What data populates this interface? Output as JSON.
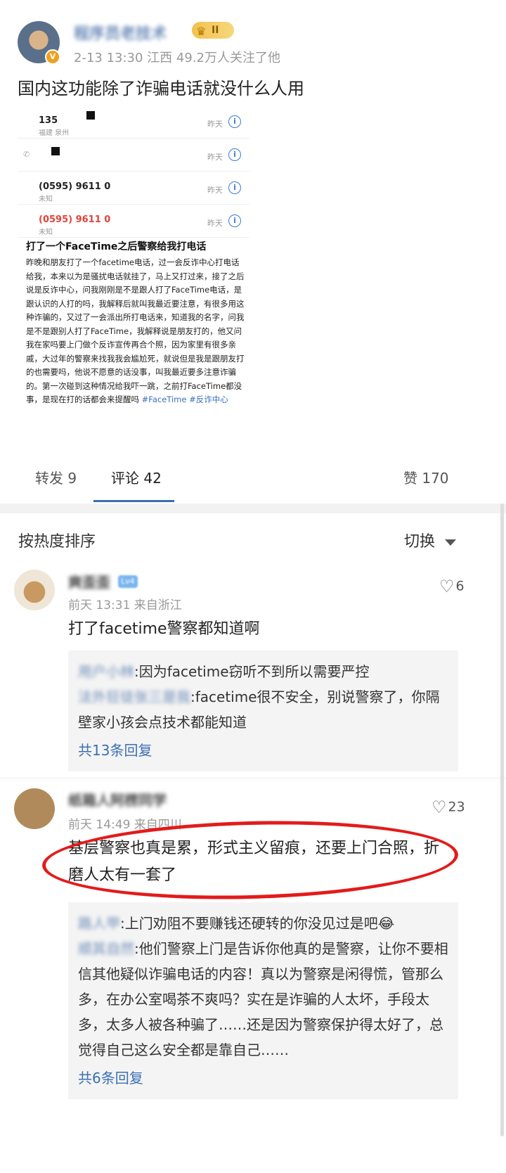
{
  "post": {
    "author_name": "程序员老技术",
    "rank_badge": "II",
    "meta": "2-13 13:30 江西 49.2万人关注了他",
    "text": "国内这功能除了诈骗电话就没什么人用"
  },
  "screenshot": {
    "calls": [
      {
        "number": "135",
        "location": "福建 泉州",
        "time": "昨天",
        "red": false
      },
      {
        "number": "",
        "location": "",
        "time": "昨天",
        "red": false
      },
      {
        "number": "(0595) 9611 0",
        "location": "未知",
        "time": "昨天",
        "red": false
      },
      {
        "number": "(0595) 9611 0",
        "location": "未知",
        "time": "昨天",
        "red": true
      }
    ],
    "title": "打了一个FaceTime之后警察给我打电话",
    "body": "昨晚和朋友打了一个facetime电话，过一会反诈中心打电话给我，本来以为是骚扰电话就挂了，马上又打过来，接了之后说是反诈中心，问我刚刚是不是跟人打了FaceTime电话，是跟认识的人打的吗，我解释后就叫我最近要注意，有很多用这种诈骗的，又过了一会派出所打电话来，知道我的名字，问我是不是跟别人打了FaceTime，我解释说是朋友打的，他又问我在家吗要上门做个反诈宣传再合个照，因为家里有很多亲戚，大过年的警察来找我我会尴尬死，就说但是我是跟朋友打的也需要吗，他说不愿意的话没事，叫我最近要多注意诈骗的。第一次碰到这种情况给我吓一跳，之前打FaceTime都没事，是现在打的话都会来提醒吗",
    "tags": "#FaceTime #反诈中心"
  },
  "tabs": {
    "repost": "转发 9",
    "comment": "评论 42",
    "like": "赞 170"
  },
  "sort": {
    "label": "按热度排序",
    "switch": "切换"
  },
  "comments": [
    {
      "name": "爽歪歪",
      "badge": "Lv4",
      "meta": "前天 13:31 来自浙江",
      "likes": "6",
      "text": "打了facetime警察都知道啊",
      "replies": [
        {
          "name": "用户小林",
          "text": ":因为facetime窃听不到所以需要严控"
        },
        {
          "name": "法外狂徒张三是我",
          "text": ":facetime很不安全，别说警察了，你隔壁家小孩会点技术都能知道"
        }
      ],
      "more": "共13条回复"
    },
    {
      "name": "纸箱人阿楞同学",
      "meta": "前天 14:49 来自四川",
      "likes": "23",
      "text": "基层警察也真是累，形式主义留痕，还要上门合照，折磨人太有一套了",
      "replies": [
        {
          "name": "路人甲",
          "text": ":上门劝阻不要赚钱还硬转的你没见过是吧😂"
        },
        {
          "name": "顺其自然",
          "text": ":他们警察上门是告诉你他真的是警察，让你不要相信其他疑似诈骗电话的内容！真以为警察是闲得慌，管那么多，在办公室喝茶不爽吗？实在是诈骗的人太坏，手段太多，太多人被各种骗了……还是因为警察保护得太好了，总觉得自己这么安全都是靠自己……"
        }
      ],
      "more": "共6条回复"
    }
  ]
}
